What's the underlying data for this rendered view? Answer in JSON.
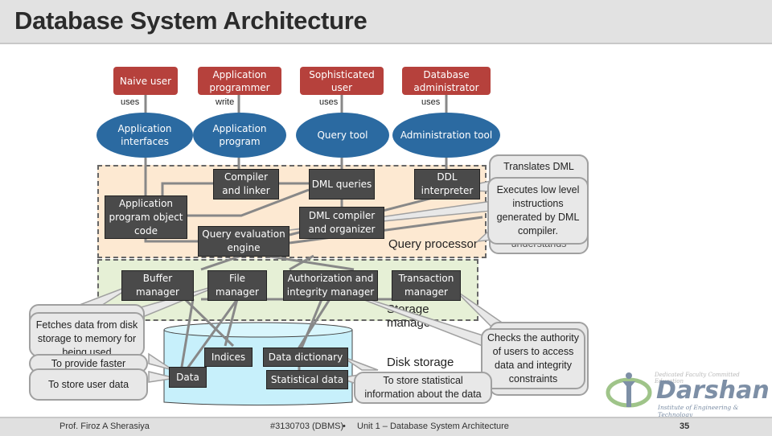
{
  "slide": {
    "title": "Database System Architecture",
    "footer": {
      "author": "Prof. Firoz A Sherasiya",
      "course": "#3130703 (DBMS)",
      "separator": "•",
      "unit": "Unit 1 – Database System Architecture",
      "page_number": "35"
    },
    "logo": {
      "tagline": "Dedicated Faculty Committed Education",
      "name": "Darshan",
      "subtitle": "Institute of Engineering & Technology"
    }
  },
  "diagram": {
    "users": [
      {
        "label": "Naive user",
        "relation": "uses"
      },
      {
        "label": "Application programmer",
        "relation": "write"
      },
      {
        "label": "Sophisticated user",
        "relation": "uses"
      },
      {
        "label": "Database administrator",
        "relation": "uses"
      }
    ],
    "interfaces": [
      {
        "label": "Application interfaces"
      },
      {
        "label": "Application program"
      },
      {
        "label": "Query tool"
      },
      {
        "label": "Administration tool"
      }
    ],
    "query_processor": {
      "label": "Query processor",
      "components": [
        {
          "label": "Compiler and linker"
        },
        {
          "label": "DML queries"
        },
        {
          "label": "DDL interpreter"
        },
        {
          "label": "Application program object code"
        },
        {
          "label": "DML compiler and organizer"
        },
        {
          "label": "Query evaluation engine"
        }
      ]
    },
    "storage_manager": {
      "label": "Storage manager",
      "components": [
        {
          "label": "Buffer manager"
        },
        {
          "label": "File manager"
        },
        {
          "label": "Authorization and integrity manager"
        },
        {
          "label": "Transaction manager"
        }
      ]
    },
    "disk_storage": {
      "label": "Disk storage",
      "components": [
        {
          "label": "Indices"
        },
        {
          "label": "Data dictionary"
        },
        {
          "label": "Data"
        },
        {
          "label": "Statistical data"
        }
      ]
    },
    "callouts": [
      {
        "text": "Translates DML",
        "state": "partially hidden"
      },
      {
        "text": "Executes low level instructions generated by DML compiler.",
        "state": "visible"
      },
      {
        "text": "understands",
        "state": "partially hidden"
      },
      {
        "text": "Fetches data from disk storage to memory for being used",
        "state": "visible"
      },
      {
        "text": "To provide faster",
        "state": "visible"
      },
      {
        "text": "To store user data",
        "state": "visible"
      },
      {
        "text": "To store statistical information about the data",
        "state": "visible"
      },
      {
        "text": "Checks the authority of users to access data and integrity constraints",
        "state": "visible"
      }
    ]
  }
}
